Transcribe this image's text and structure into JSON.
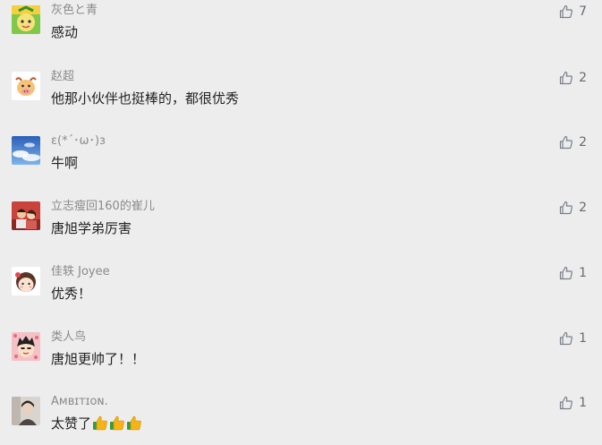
{
  "like_icon": "thumbs-up-outline-icon",
  "comments": [
    {
      "nickname": "灰色と青",
      "content": "感动",
      "likes": "7",
      "avatar": "cartoon-fruit-avatar"
    },
    {
      "nickname": "赵超",
      "content": "他那小伙伴也挺棒的，都很优秀",
      "likes": "2",
      "avatar": "cartoon-cow-avatar"
    },
    {
      "nickname": "ε(*´･ω･)з",
      "content": "牛啊",
      "likes": "2",
      "avatar": "blue-sky-avatar"
    },
    {
      "nickname": "立志瘦回160的崔儿",
      "content": "唐旭学弟厉害",
      "likes": "2",
      "avatar": "photo-couple-avatar"
    },
    {
      "nickname": "佳轶 Joyee",
      "content": "优秀！",
      "likes": "1",
      "avatar": "cartoon-girl-avatar"
    },
    {
      "nickname": "类人鸟",
      "content": "唐旭更帅了！！",
      "likes": "1",
      "avatar": "cartoon-boy-avatar"
    },
    {
      "nickname": "Aᴍʙɪᴛɪᴏɴ.",
      "content": "太赞了",
      "likes": "1",
      "avatar": "portrait-photo-avatar",
      "emojis": [
        "thumbs-up-emoji",
        "thumbs-up-emoji",
        "thumbs-up-emoji"
      ]
    }
  ]
}
